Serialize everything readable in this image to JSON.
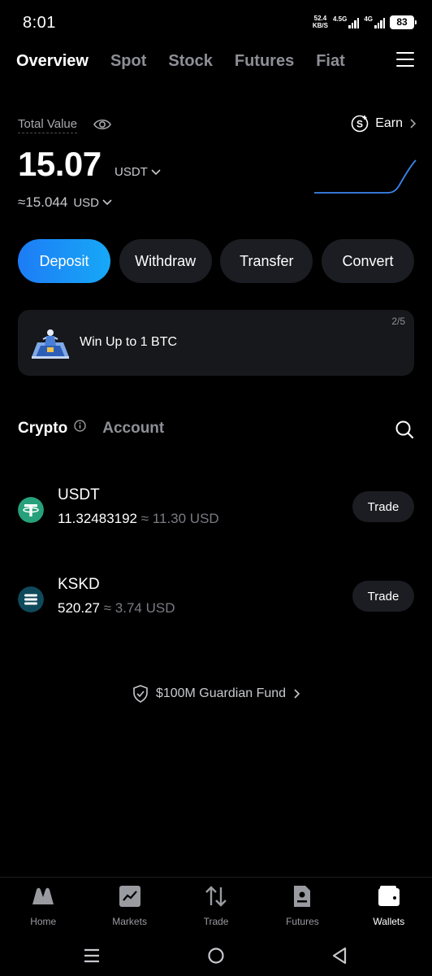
{
  "status_bar": {
    "time": "8:01",
    "net_speed_value": "52.4",
    "net_speed_unit": "KB/S",
    "sig1_label": "4.5G",
    "sig2_label": "4G",
    "battery": "83"
  },
  "top_tabs": [
    {
      "label": "Overview",
      "active": true
    },
    {
      "label": "Spot",
      "active": false
    },
    {
      "label": "Stock",
      "active": false
    },
    {
      "label": "Futures",
      "active": false
    },
    {
      "label": "Fiat",
      "active": false
    }
  ],
  "overview": {
    "total_label": "Total Value",
    "earn_label": "Earn",
    "balance": "15.07",
    "balance_unit": "USDT",
    "usd_value": "≈15.044",
    "usd_unit": "USD"
  },
  "actions": {
    "deposit": "Deposit",
    "withdraw": "Withdraw",
    "transfer": "Transfer",
    "convert": "Convert"
  },
  "promo": {
    "text": "Win Up to 1 BTC",
    "page": "2/5"
  },
  "section_tabs": {
    "crypto": "Crypto",
    "account": "Account"
  },
  "assets": [
    {
      "symbol": "USDT",
      "amount": "11.32483192",
      "approx": "≈ 11.30 USD",
      "trade": "Trade",
      "color": "#26a17b"
    },
    {
      "symbol": "KSKD",
      "amount": "520.27",
      "approx": "≈ 3.74 USD",
      "trade": "Trade",
      "color": "#0f4a5c"
    }
  ],
  "guardian": "$100M Guardian Fund",
  "bottom_nav": {
    "home": "Home",
    "markets": "Markets",
    "trade": "Trade",
    "futures": "Futures",
    "wallets": "Wallets"
  },
  "colors": {
    "accent": "#1d7cf5",
    "background": "#000000",
    "card": "#1c1d22",
    "muted": "#8e8f96"
  }
}
